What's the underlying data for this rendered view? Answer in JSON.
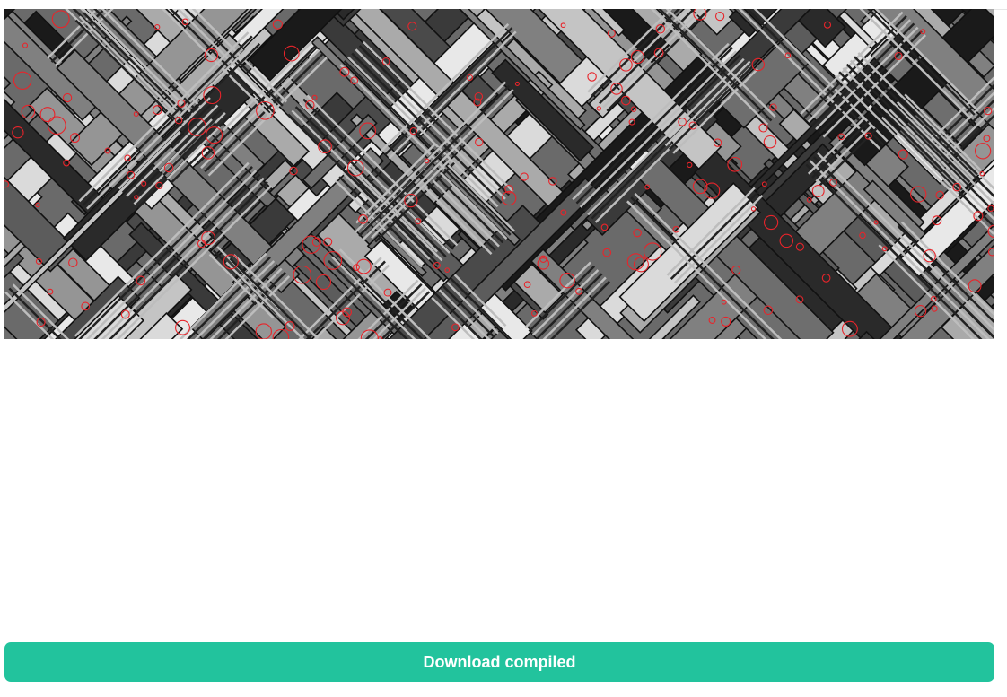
{
  "download_button": {
    "label": "Download compiled"
  },
  "colors": {
    "accent": "#22c39d",
    "button_text": "#ffffff",
    "detection_circle": "#e8242a"
  },
  "preview": {
    "icon": "abstract-pattern-image-with-detections"
  }
}
